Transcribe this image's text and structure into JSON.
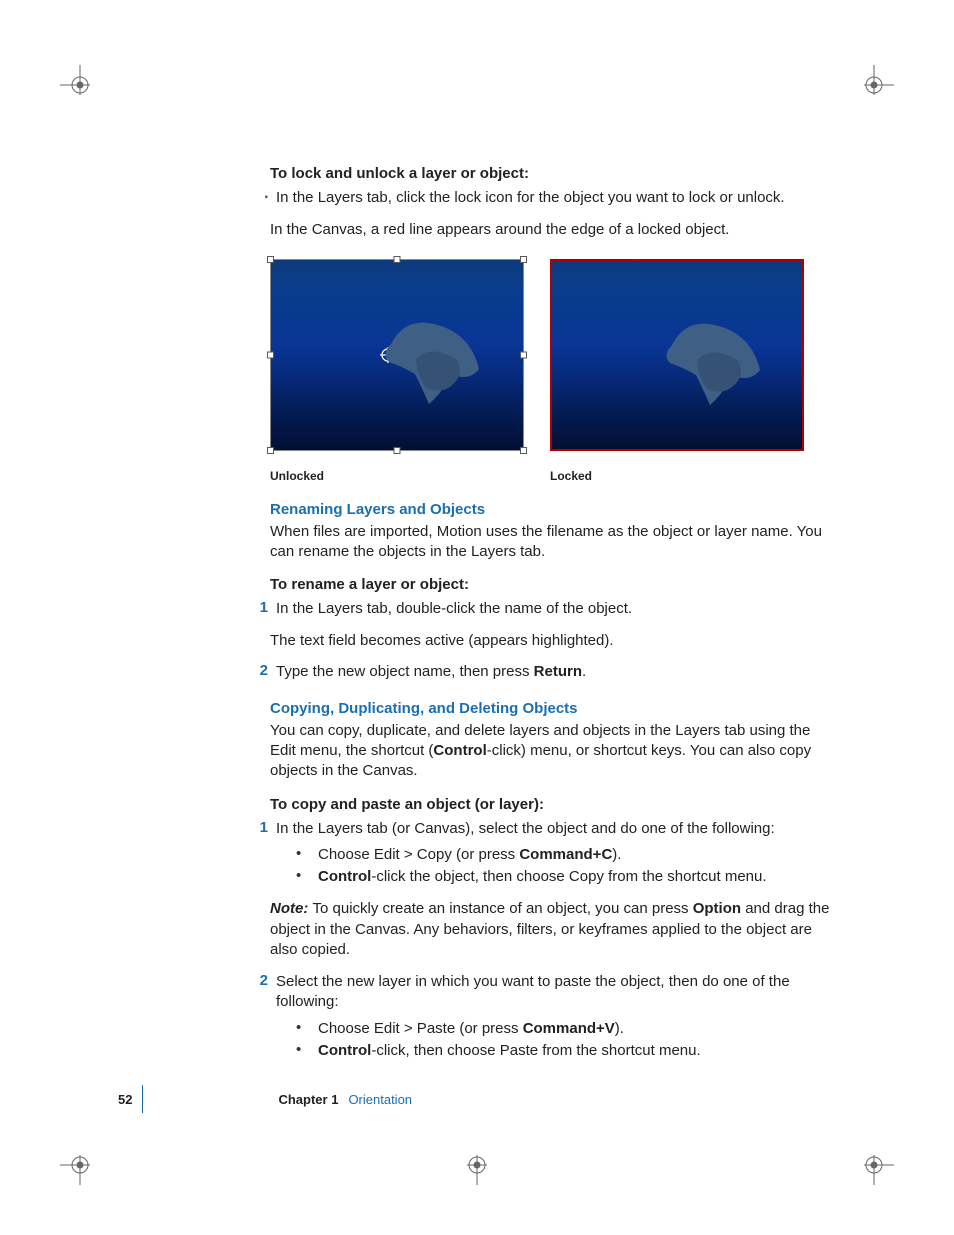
{
  "sections": {
    "lock": {
      "heading": "To lock and unlock a layer or object:",
      "bullet": "In the Layers tab, click the lock icon for the object you want to lock or unlock.",
      "after": "In the Canvas, a red line appears around the edge of a locked object."
    },
    "figure": {
      "unlocked_caption": "Unlocked",
      "locked_caption": "Locked"
    },
    "rename": {
      "heading": "Renaming Layers and Objects",
      "intro": "When files are imported, Motion uses the filename as the object or layer name. You can rename the objects in the Layers tab.",
      "task_heading": "To rename a layer or object:",
      "step1": "In the Layers tab, double-click the name of the object.",
      "step1_after": "The text field becomes active (appears highlighted).",
      "step2_pre": "Type the new object name, then press ",
      "step2_kbd": "Return",
      "step2_post": "."
    },
    "copy": {
      "heading": "Copying, Duplicating, and Deleting Objects",
      "intro_pre": "You can copy, duplicate, and delete layers and objects in the Layers tab using the Edit menu, the shortcut (",
      "intro_kbd": "Control",
      "intro_post": "-click) menu, or shortcut keys. You can also copy objects in the Canvas.",
      "task_heading": "To copy and paste an object (or layer):",
      "step1": "In the Layers tab (or Canvas), select the object and do one of the following:",
      "step1_sub1_pre": "Choose Edit > Copy (or press ",
      "step1_sub1_kbd": "Command+C",
      "step1_sub1_post": ").",
      "step1_sub2_kbd": "Control",
      "step1_sub2_post": "-click the object, then choose Copy from the shortcut menu.",
      "note_label": "Note:  ",
      "note_pre": "To quickly create an instance of an object, you can press ",
      "note_kbd": "Option",
      "note_post": " and drag the object in the Canvas. Any behaviors, filters, or keyframes applied to the object are also copied.",
      "step2": "Select the new layer in which you want to paste the object, then do one of the following:",
      "step2_sub1_pre": "Choose Edit > Paste (or press ",
      "step2_sub1_kbd": "Command+V",
      "step2_sub1_post": ").",
      "step2_sub2_kbd": "Control",
      "step2_sub2_post": "-click, then choose Paste from the shortcut menu."
    }
  },
  "footer": {
    "page": "52",
    "chapter_label": "Chapter 1",
    "chapter_name": "Orientation"
  },
  "numbers": {
    "one": "1",
    "two": "2"
  }
}
